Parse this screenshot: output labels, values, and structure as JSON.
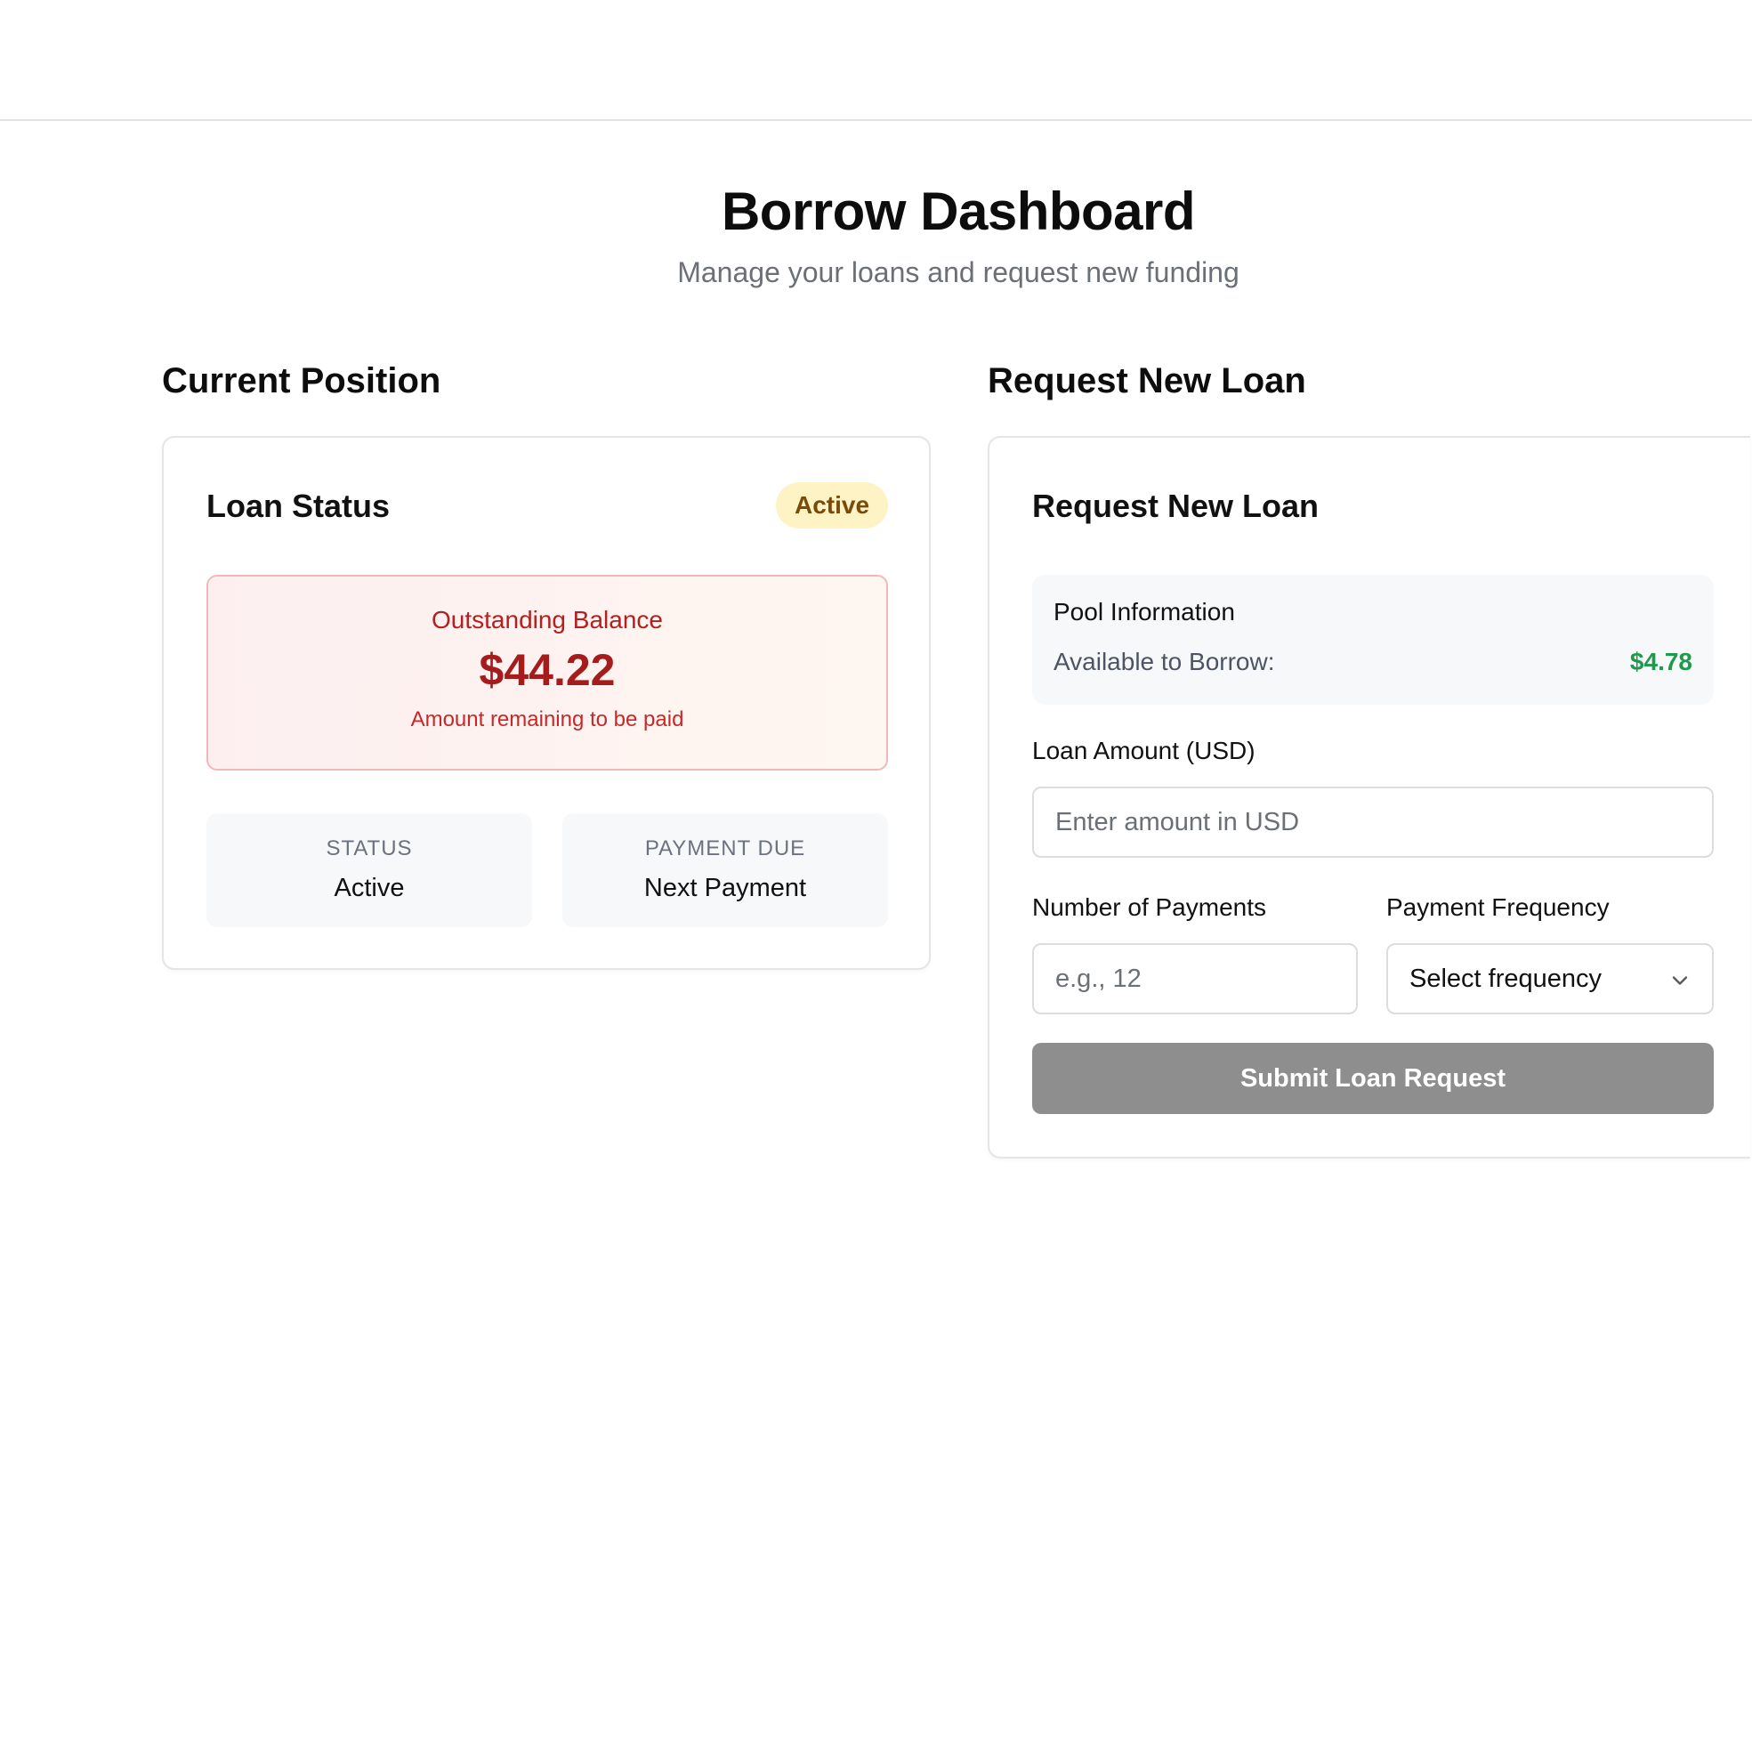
{
  "header": {
    "title": "Borrow Dashboard",
    "subtitle": "Manage your loans and request new funding"
  },
  "current_position": {
    "section_title": "Current Position",
    "card_title": "Loan Status",
    "badge": "Active",
    "balance": {
      "label": "Outstanding Balance",
      "value": "$44.22",
      "note": "Amount remaining to be paid"
    },
    "stats": [
      {
        "label": "STATUS",
        "value": "Active"
      },
      {
        "label": "PAYMENT DUE",
        "value": "Next Payment"
      }
    ]
  },
  "request_loan": {
    "section_title": "Request New Loan",
    "card_title": "Request New Loan",
    "pool": {
      "title": "Pool Information",
      "available_label": "Available to Borrow:",
      "available_value": "$4.78"
    },
    "loan_amount": {
      "label": "Loan Amount (USD)",
      "placeholder": "Enter amount in USD",
      "value": ""
    },
    "num_payments": {
      "label": "Number of Payments",
      "placeholder": "e.g., 12",
      "value": ""
    },
    "frequency": {
      "label": "Payment Frequency",
      "selected": "Select frequency",
      "icon": "chevron-down-icon"
    },
    "submit_label": "Submit Loan Request"
  },
  "colors": {
    "danger_text": "#a51c1c",
    "success_text": "#1e9a4a",
    "badge_bg": "#fdf3c4",
    "button_disabled": "#8e8e8e"
  }
}
